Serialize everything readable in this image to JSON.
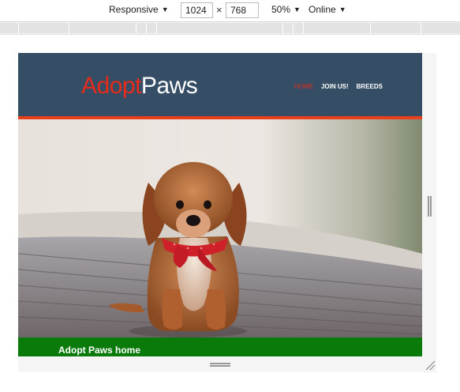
{
  "devtools": {
    "device_mode": "Responsive",
    "width_value": "1024",
    "height_value": "768",
    "times_symbol": "×",
    "zoom": "50%",
    "network": "Online",
    "dropdown_glyph": "▼"
  },
  "site": {
    "brand_part1": "Adopt",
    "brand_part2": "Paws",
    "nav": [
      {
        "label": "HOME",
        "active": true
      },
      {
        "label": "JOIN US!",
        "active": false
      },
      {
        "label": "BREEDS",
        "active": false
      }
    ],
    "hero_subject": "puppy with red bandana sitting on wooden boardwalk",
    "footer_title": "Adopt Paws home"
  },
  "colors": {
    "header_bg": "#354e66",
    "brand_red": "#e82a1a",
    "strip": "#e8401a",
    "green_bar": "#0a7a0a"
  }
}
